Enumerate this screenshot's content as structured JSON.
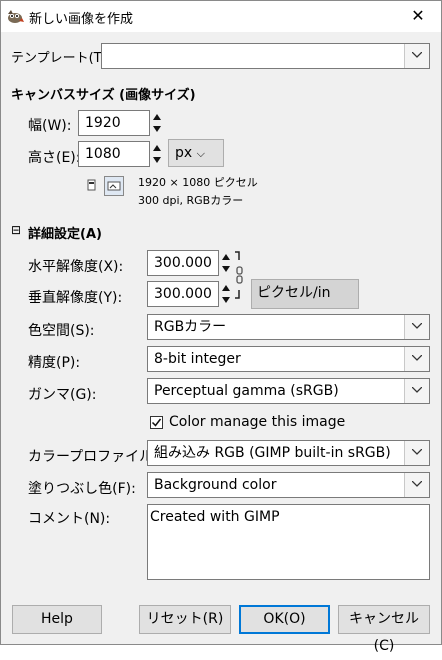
{
  "window": {
    "title": "新しい画像を作成",
    "close_glyph": "✕"
  },
  "template": {
    "label": "テンプレート(T):",
    "value": ""
  },
  "canvas_size": {
    "heading": "キャンバスサイズ (画像サイズ)",
    "width_label": "幅(W):",
    "width_value": "1920",
    "height_label": "高さ(E):",
    "height_value": "1080",
    "unit": "px",
    "unit_arrow": "⌵",
    "info_line1": "1920 × 1080 ピクセル",
    "info_line2": "300 dpi, RGBカラー"
  },
  "advanced": {
    "toggle": "⊟",
    "heading": "詳細設定(A)",
    "x_res_label": "水平解像度(X):",
    "x_res_value": "300.000",
    "y_res_label": "垂直解像度(Y):",
    "y_res_value": "300.000",
    "res_unit": "ピクセル/in",
    "colorspace_label": "色空間(S):",
    "colorspace_value": "RGBカラー",
    "precision_label": "精度(P):",
    "precision_value": "8-bit integer",
    "gamma_label": "ガンマ(G):",
    "gamma_value": "Perceptual gamma (sRGB)",
    "color_manage_label": "Color manage this image",
    "color_manage_checked": true,
    "profile_label": "カラープロファイル(L):",
    "profile_value": "組み込み RGB (GIMP built-in sRGB)",
    "fill_label": "塗りつぶし色(F):",
    "fill_value": "Background color",
    "comment_label": "コメント(N):",
    "comment_value": "Created with GIMP"
  },
  "buttons": {
    "help": "Help",
    "reset": "リセット(R)",
    "ok": "OK(O)",
    "cancel": "キャンセル(C)"
  }
}
